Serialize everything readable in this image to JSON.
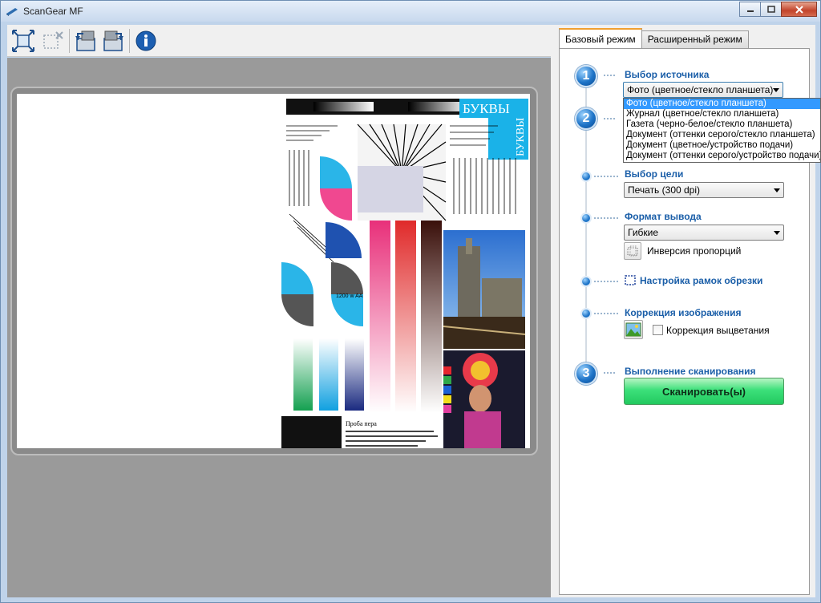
{
  "window": {
    "title": "ScanGear MF"
  },
  "toolbar": {
    "buttons": [
      {
        "icon": "auto-crop-icon"
      },
      {
        "icon": "remove-crop-icon"
      },
      {
        "icon": "rotate-left-icon"
      },
      {
        "icon": "rotate-right-icon"
      },
      {
        "icon": "info-icon"
      }
    ]
  },
  "tabs": [
    {
      "label": "Базовый режим",
      "active": true
    },
    {
      "label": "Расширенный режим",
      "active": false
    }
  ],
  "steps": {
    "step1": {
      "number": "1",
      "title": "Выбор источника",
      "selected": "Фото (цветное/стекло планшета)"
    },
    "step2": {
      "number": "2"
    },
    "target": {
      "title": "Выбор цели",
      "selected": "Печать (300 dpi)"
    },
    "output": {
      "title": "Формат вывода",
      "selected": "Гибкие",
      "invert_label": "Инверсия пропорций"
    },
    "crop": {
      "title": "Настройка рамок обрезки"
    },
    "correction": {
      "title": "Коррекция изображения",
      "fade_label": "Коррекция выцветания"
    },
    "step3": {
      "number": "3",
      "title": "Выполнение сканирования",
      "button": "Сканировать(ы)"
    }
  },
  "source_options": [
    "Фото (цветное/стекло планшета)",
    "Журнал (цветное/стекло планшета)",
    "Газета (черно-белое/стекло планшета)",
    "Документ (оттенки серого/стекло планшета)",
    "Документ (цветное/устройство подачи)",
    "Документ (оттенки серого/устройство подачи)"
  ],
  "preview": {
    "test_chart": {
      "labels": [
        "БУКВЫ",
        "БУКВЫ",
        "Проба пера",
        "1200 w AA"
      ]
    }
  },
  "colors": {
    "accent": "#1a5ea8",
    "scan_button": "#2ad167",
    "selection": "#3399ff"
  }
}
